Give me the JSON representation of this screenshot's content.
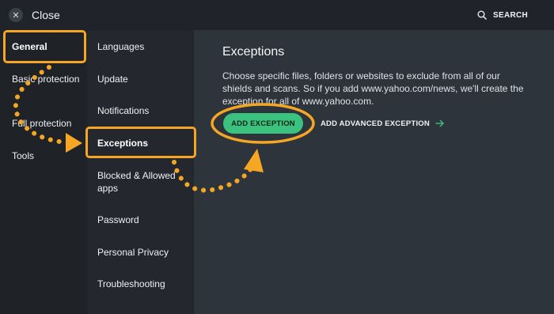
{
  "window": {
    "close_label": "Close",
    "search_label": "SEARCH"
  },
  "sidebar": {
    "items": [
      {
        "label": "General",
        "active": true
      },
      {
        "label": "Basic protection"
      },
      {
        "label": "Full protection"
      },
      {
        "label": "Tools"
      }
    ]
  },
  "submenu": {
    "items": [
      {
        "label": "Languages"
      },
      {
        "label": "Update"
      },
      {
        "label": "Notifications"
      },
      {
        "label": "Exceptions",
        "active": true
      },
      {
        "label": "Blocked & Allowed apps"
      },
      {
        "label": "Password"
      },
      {
        "label": "Personal Privacy"
      },
      {
        "label": "Troubleshooting"
      }
    ]
  },
  "main": {
    "title": "Exceptions",
    "description": "Choose specific files, folders or websites to exclude from all of our shields and scans. So if you add www.yahoo.com/news, we'll create the exception for all of www.yahoo.com.",
    "add_button": "ADD EXCEPTION",
    "advanced_button": "ADD ADVANCED EXCEPTION"
  },
  "colors": {
    "accent_green": "#3ac27e",
    "highlight_orange": "#f5a623",
    "arrow_green": "#3ac27e"
  },
  "icons": [
    "close-icon",
    "search-icon",
    "arrow-right-icon"
  ]
}
